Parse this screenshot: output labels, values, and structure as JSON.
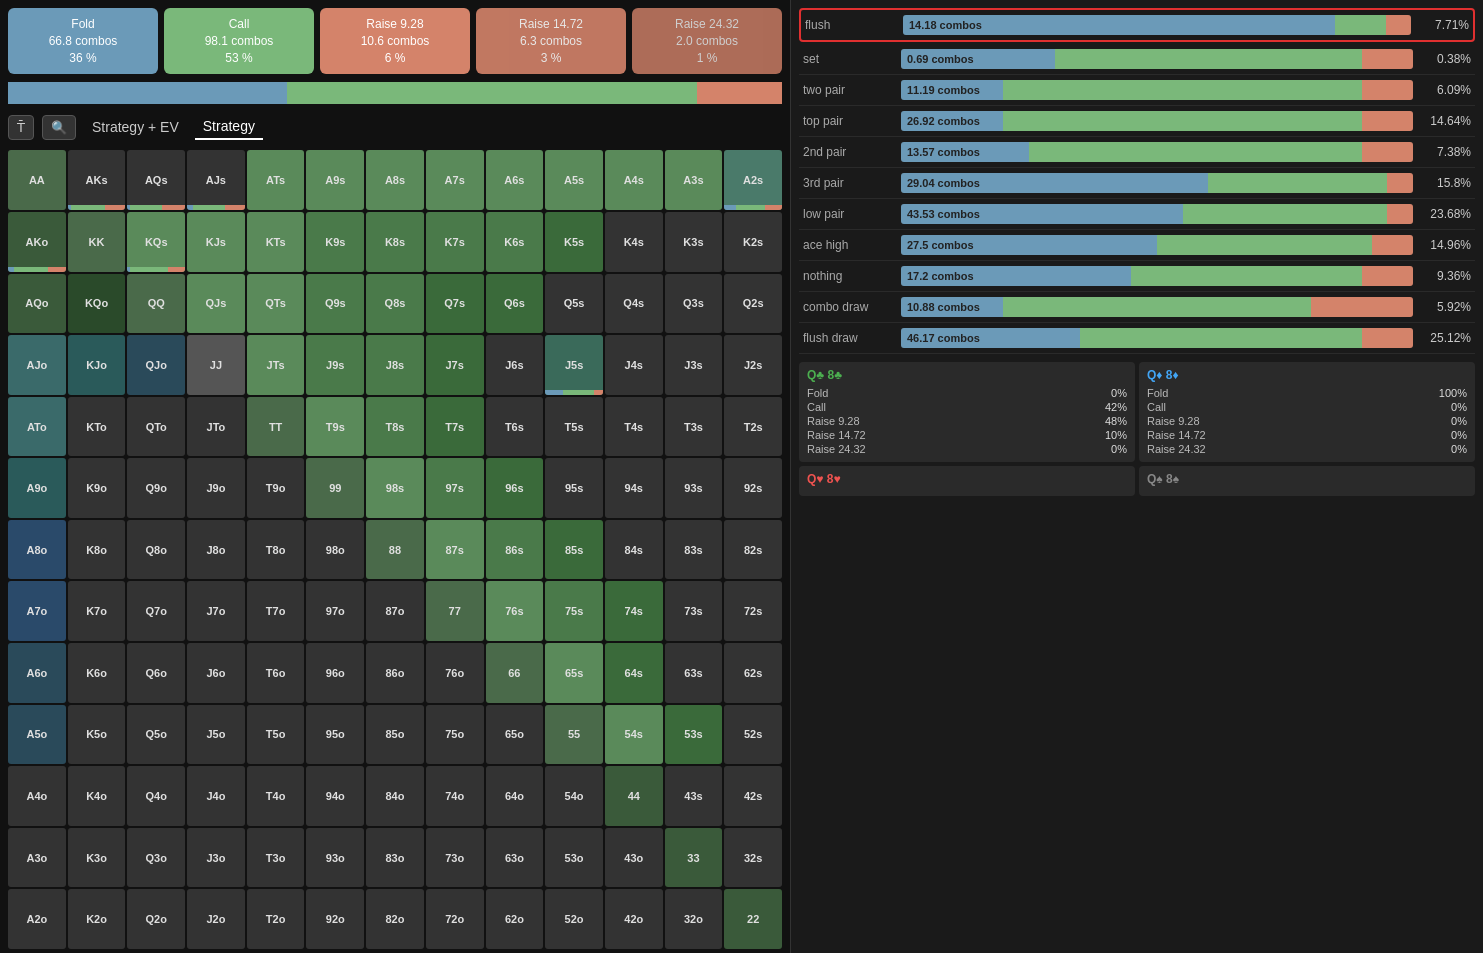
{
  "actions": [
    {
      "id": "fold",
      "label": "Fold",
      "combos": "66.8 combos",
      "pct": "36 %",
      "class": "btn-fold"
    },
    {
      "id": "call",
      "label": "Call",
      "combos": "98.1 combos",
      "pct": "53 %",
      "class": "btn-call"
    },
    {
      "id": "raise928",
      "label": "Raise 9.28",
      "combos": "10.6 combos",
      "pct": "6 %",
      "class": "btn-raise928"
    },
    {
      "id": "raise1472",
      "label": "Raise 14.72",
      "combos": "6.3 combos",
      "pct": "3 %",
      "class": "btn-raise1472"
    },
    {
      "id": "raise2432",
      "label": "Raise 24.32",
      "combos": "2.0 combos",
      "pct": "1 %",
      "class": "btn-raise2432"
    }
  ],
  "controls": {
    "t_label": "T",
    "search_label": "🔍",
    "tab1": "Strategy + EV",
    "tab2": "Strategy"
  },
  "hand_types": [
    {
      "id": "flush",
      "label": "flush",
      "combos": "14.18 combos",
      "pct": "7.71%",
      "blue": 85,
      "green": 10,
      "orange": 5,
      "highlighted": true
    },
    {
      "id": "set",
      "label": "set",
      "combos": "0.69 combos",
      "pct": "0.38%",
      "blue": 30,
      "green": 60,
      "orange": 10,
      "highlighted": false
    },
    {
      "id": "two_pair",
      "label": "two pair",
      "combos": "11.19 combos",
      "pct": "6.09%",
      "blue": 20,
      "green": 70,
      "orange": 10,
      "highlighted": false
    },
    {
      "id": "top_pair",
      "label": "top pair",
      "combos": "26.92 combos",
      "pct": "14.64%",
      "blue": 20,
      "green": 70,
      "orange": 10,
      "highlighted": false
    },
    {
      "id": "2nd_pair",
      "label": "2nd pair",
      "combos": "13.57 combos",
      "pct": "7.38%",
      "blue": 25,
      "green": 65,
      "orange": 10,
      "highlighted": false
    },
    {
      "id": "3rd_pair",
      "label": "3rd pair",
      "combos": "29.04 combos",
      "pct": "15.8%",
      "blue": 60,
      "green": 35,
      "orange": 5,
      "highlighted": false
    },
    {
      "id": "low_pair",
      "label": "low pair",
      "combos": "43.53 combos",
      "pct": "23.68%",
      "blue": 55,
      "green": 40,
      "orange": 5,
      "highlighted": false
    },
    {
      "id": "ace_high",
      "label": "ace high",
      "combos": "27.5 combos",
      "pct": "14.96%",
      "blue": 50,
      "green": 42,
      "orange": 8,
      "highlighted": false
    },
    {
      "id": "nothing",
      "label": "nothing",
      "combos": "17.2 combos",
      "pct": "9.36%",
      "blue": 45,
      "green": 45,
      "orange": 10,
      "highlighted": false
    },
    {
      "id": "combo_draw",
      "label": "combo draw",
      "combos": "10.88 combos",
      "pct": "5.92%",
      "blue": 20,
      "green": 60,
      "orange": 20,
      "highlighted": false
    },
    {
      "id": "flush_draw",
      "label": "flush draw",
      "combos": "46.17 combos",
      "pct": "25.12%",
      "blue": 35,
      "green": 55,
      "orange": 10,
      "highlighted": false
    }
  ],
  "card_blocks": [
    {
      "id": "qc8c",
      "header_suit1": "Q♣",
      "header_suit2": "8♣",
      "header_color1": "green",
      "header_color2": "green",
      "rows": [
        {
          "label": "Fold",
          "val": "0%"
        },
        {
          "label": "Call",
          "val": "42%"
        },
        {
          "label": "Raise 9.28",
          "val": "48%"
        },
        {
          "label": "Raise 14.72",
          "val": "10%"
        },
        {
          "label": "Raise 24.32",
          "val": "0%"
        }
      ]
    },
    {
      "id": "qd8d",
      "header_suit1": "Q♦",
      "header_suit2": "8♦",
      "header_color1": "blue",
      "header_color2": "blue",
      "rows": [
        {
          "label": "Fold",
          "val": "100%"
        },
        {
          "label": "Call",
          "val": "0%"
        },
        {
          "label": "Raise 9.28",
          "val": "0%"
        },
        {
          "label": "Raise 14.72",
          "val": "0%"
        },
        {
          "label": "Raise 24.32",
          "val": "0%"
        }
      ]
    },
    {
      "id": "qh8h",
      "header_suit1": "Q♥",
      "header_suit2": "8♥",
      "header_color1": "red",
      "header_color2": "red",
      "rows": []
    },
    {
      "id": "qs8s",
      "header_suit1": "Q♠",
      "header_suit2": "8♠",
      "header_color1": "gray",
      "header_color2": "gray",
      "rows": []
    }
  ],
  "matrix_rows": [
    [
      "AA",
      "AKs",
      "AQs",
      "AJs",
      "ATs",
      "A9s",
      "A8s",
      "A7s",
      "A6s",
      "A5s",
      "A4s",
      "A3s",
      "A2s"
    ],
    [
      "AKo",
      "KK",
      "KQs",
      "KJs",
      "KTs",
      "K9s",
      "K8s",
      "K7s",
      "K6s",
      "K5s",
      "K4s",
      "K3s",
      "K2s"
    ],
    [
      "AQo",
      "KQo",
      "QQ",
      "QJs",
      "QTs",
      "Q9s",
      "Q8s",
      "Q7s",
      "Q6s",
      "Q5s",
      "Q4s",
      "Q3s",
      "Q2s"
    ],
    [
      "AJo",
      "KJo",
      "QJo",
      "JJ",
      "JTs",
      "J9s",
      "J8s",
      "J7s",
      "J6s",
      "J5s",
      "J4s",
      "J3s",
      "J2s"
    ],
    [
      "ATo",
      "KTo",
      "QTo",
      "JTo",
      "TT",
      "T9s",
      "T8s",
      "T7s",
      "T6s",
      "T5s",
      "T4s",
      "T3s",
      "T2s"
    ],
    [
      "A9o",
      "K9o",
      "Q9o",
      "J9o",
      "T9o",
      "99",
      "98s",
      "97s",
      "96s",
      "95s",
      "94s",
      "93s",
      "92s"
    ],
    [
      "A8o",
      "K8o",
      "Q8o",
      "J8o",
      "T8o",
      "98o",
      "88",
      "87s",
      "86s",
      "85s",
      "84s",
      "83s",
      "82s"
    ],
    [
      "A7o",
      "K7o",
      "Q7o",
      "J7o",
      "T7o",
      "97o",
      "87o",
      "77",
      "76s",
      "75s",
      "74s",
      "73s",
      "72s"
    ],
    [
      "A6o",
      "K6o",
      "Q6o",
      "J6o",
      "T6o",
      "96o",
      "86o",
      "76o",
      "66",
      "65s",
      "64s",
      "63s",
      "62s"
    ],
    [
      "A5o",
      "K5o",
      "Q5o",
      "J5o",
      "T5o",
      "95o",
      "85o",
      "75o",
      "65o",
      "55",
      "54s",
      "53s",
      "52s"
    ],
    [
      "A4o",
      "K4o",
      "Q4o",
      "J4o",
      "T4o",
      "94o",
      "84o",
      "74o",
      "64o",
      "54o",
      "44",
      "43s",
      "42s"
    ],
    [
      "A3o",
      "K3o",
      "Q3o",
      "J3o",
      "T3o",
      "93o",
      "83o",
      "73o",
      "63o",
      "53o",
      "43o",
      "33",
      "32s"
    ],
    [
      "A2o",
      "K2o",
      "Q2o",
      "J2o",
      "T2o",
      "92o",
      "82o",
      "72o",
      "62o",
      "52o",
      "42o",
      "32o",
      "22"
    ]
  ]
}
